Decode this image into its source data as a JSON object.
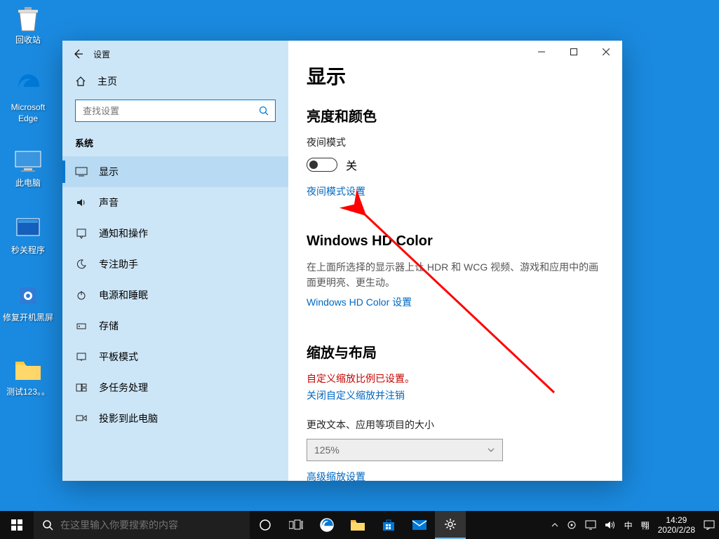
{
  "desktop": [
    {
      "label": "回收站"
    },
    {
      "label": "Microsoft Edge"
    },
    {
      "label": "此电脑"
    },
    {
      "label": "秒关程序"
    },
    {
      "label": "修复开机黑屏"
    },
    {
      "label": "测试123。。"
    }
  ],
  "window": {
    "title": "设置",
    "home": "主页",
    "search_placeholder": "查找设置",
    "category": "系统",
    "items": [
      {
        "label": "显示",
        "active": true
      },
      {
        "label": "声音"
      },
      {
        "label": "通知和操作"
      },
      {
        "label": "专注助手"
      },
      {
        "label": "电源和睡眠"
      },
      {
        "label": "存储"
      },
      {
        "label": "平板模式"
      },
      {
        "label": "多任务处理"
      },
      {
        "label": "投影到此电脑"
      }
    ]
  },
  "content": {
    "h1": "显示",
    "sec1": {
      "title": "亮度和颜色",
      "night_label": "夜间模式",
      "toggle_state": "关",
      "link": "夜间模式设置"
    },
    "sec2": {
      "title": "Windows HD Color",
      "desc": "在上面所选择的显示器上让 HDR 和 WCG 视频、游戏和应用中的画面更明亮、更生动。",
      "link": "Windows HD Color 设置"
    },
    "sec3": {
      "title": "缩放与布局",
      "warn": "自定义缩放比例已设置。",
      "link1": "关闭自定义缩放并注销",
      "size_label": "更改文本、应用等项目的大小",
      "scale_value": "125%",
      "link2": "高级缩放设置"
    }
  },
  "taskbar": {
    "search_placeholder": "在这里输入你要搜索的内容",
    "ime1": "中",
    "ime2": "翈",
    "time": "14:29",
    "date": "2020/2/28"
  }
}
